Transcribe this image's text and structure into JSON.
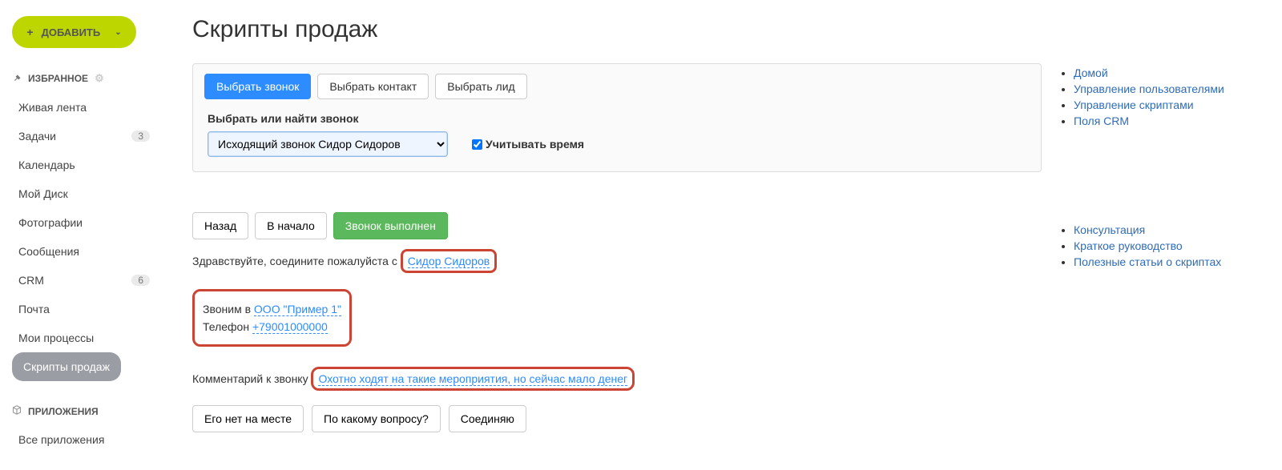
{
  "sidebar": {
    "addLabel": "ДОБАВИТЬ",
    "favHeader": "ИЗБРАННОЕ",
    "items": [
      {
        "label": "Живая лента",
        "badge": null,
        "active": false
      },
      {
        "label": "Задачи",
        "badge": "3",
        "active": false
      },
      {
        "label": "Календарь",
        "badge": null,
        "active": false
      },
      {
        "label": "Мой Диск",
        "badge": null,
        "active": false
      },
      {
        "label": "Фотографии",
        "badge": null,
        "active": false
      },
      {
        "label": "Сообщения",
        "badge": null,
        "active": false
      },
      {
        "label": "CRM",
        "badge": "6",
        "active": false
      },
      {
        "label": "Почта",
        "badge": null,
        "active": false
      },
      {
        "label": "Мои процессы",
        "badge": null,
        "active": false
      },
      {
        "label": "Скрипты продаж",
        "badge": null,
        "active": true
      }
    ],
    "appsHeader": "ПРИЛОЖЕНИЯ",
    "appsItem": "Все приложения"
  },
  "page": {
    "title": "Скрипты продаж"
  },
  "picker": {
    "tabs": [
      "Выбрать звонок",
      "Выбрать контакт",
      "Выбрать лид"
    ],
    "activeTab": 0,
    "label": "Выбрать или найти звонок",
    "selected": "Исходящий звонок Сидор Сидоров",
    "checkboxLabel": "Учитывать время"
  },
  "nav": {
    "back": "Назад",
    "start": "В начало",
    "done": "Звонок выполнен"
  },
  "greet": {
    "prefix": "Здравствуйте, соедините пожалуйста с ",
    "name": "Сидор Сидоров"
  },
  "info": {
    "callPrefix": "Звоним в ",
    "company": "ООО \"Пример 1\"",
    "phonePrefix": "Телефон ",
    "phone": "+79001000000"
  },
  "comment": {
    "prefix": "Комментарий к звонку ",
    "text": "Охотно ходят на такие мероприятия, но сейчас мало денег"
  },
  "options": [
    "Его нет на месте",
    "По какому вопросу?",
    "Соединяю"
  ],
  "sideLinks1": [
    "Домой",
    "Управление пользователями",
    "Управление скриптами",
    "Поля CRM"
  ],
  "sideLinks2": [
    "Консультация",
    "Краткое руководство",
    "Полезные статьи о скриптах"
  ]
}
